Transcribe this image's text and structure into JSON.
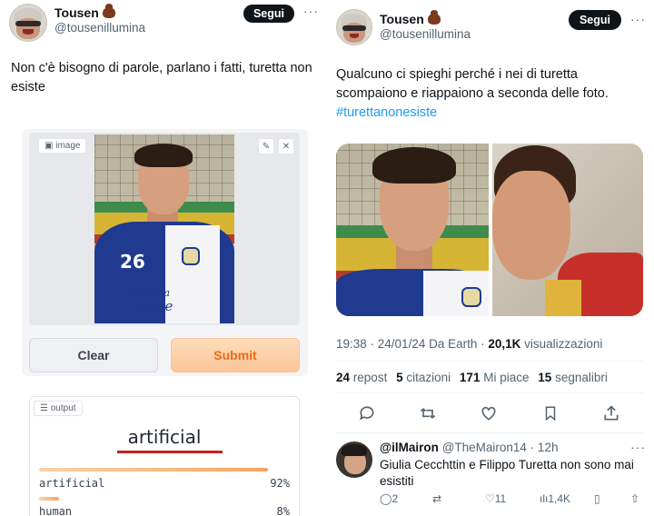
{
  "left": {
    "author_name": "Tousen",
    "author_handle": "@tousenillumina",
    "follow_label": "Segui",
    "more_icon": "more-icon",
    "text": "Non c'è bisogno di parole, parlano i fatti, turetta non esiste",
    "gradio": {
      "image_label": "image",
      "edit_icon": "pencil-icon",
      "close_icon": "close-icon",
      "jersey_number": "26",
      "sponsor_line1": "Toscana",
      "sponsor_line2": "Village",
      "clear_label": "Clear",
      "submit_label": "Submit",
      "output_label": "output",
      "prediction": "artificial",
      "confidences": [
        {
          "label": "artificial",
          "value_text": "92%",
          "value": 0.92
        },
        {
          "label": "human",
          "value_text": "8%",
          "value": 0.08
        }
      ]
    }
  },
  "right": {
    "author_name": "Tousen",
    "author_handle": "@tousenillumina",
    "follow_label": "Segui",
    "text": "Qualcuno ci spieghi perché i nei di turetta scompaiono e riappaiono a seconda delle foto.",
    "hashtag": "#turettanonesiste",
    "meta_time": "19:38 · 24/01/24 Da Earth · ",
    "meta_views_count": "20,1K",
    "meta_views_label": " visualizzazioni",
    "stats": [
      {
        "count": "24",
        "label": "repost"
      },
      {
        "count": "5",
        "label": "citazioni"
      },
      {
        "count": "171",
        "label": "Mi piace"
      },
      {
        "count": "15",
        "label": "segnalibri"
      }
    ],
    "actions": [
      "reply-icon",
      "retweet-icon",
      "like-icon",
      "bookmark-icon",
      "share-icon"
    ],
    "reply": {
      "name": "@ilMairon",
      "handle": "@TheMairon14 · 12h",
      "text": "Giulia Cecchttin e Filippo Turetta non sono mai esistiti",
      "replies": "2",
      "likes": "11",
      "views": "1,4K"
    }
  }
}
